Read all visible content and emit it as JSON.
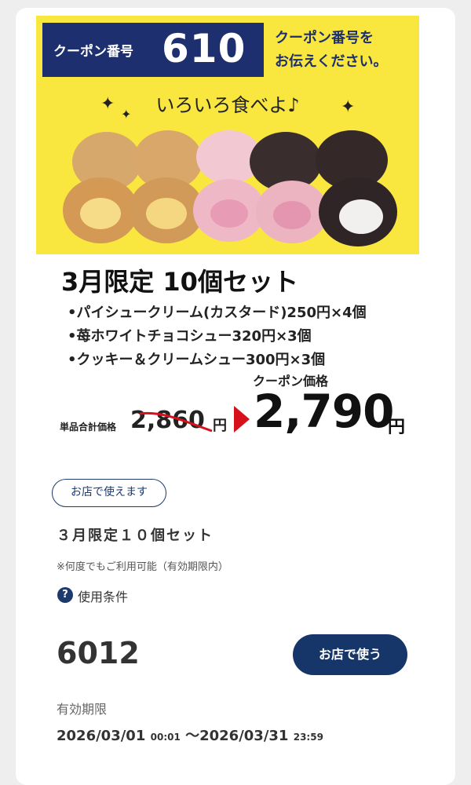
{
  "promo": {
    "coupon_label": "クーポン番号",
    "coupon_number": "610",
    "tell_line1": "クーポン番号を",
    "tell_line2": "お伝えください。",
    "tagline": "いろいろ食べよ♪",
    "colors": {
      "banner_bg": "#f9e740",
      "coupon_box": "#1d2f6e",
      "price_arrow": "#d6111b"
    }
  },
  "set": {
    "title": "3月限定 10個セット",
    "items": [
      "•パイシュークリーム(カスタード)250円×4個",
      "•苺ホワイトチョコシュー320円×3個",
      "•クッキー＆クリームシュー300円×3個"
    ],
    "coupon_price_label": "クーポン価格",
    "single_total_label": "単品合計価格",
    "old_price": "2,860",
    "old_price_yen": "円",
    "new_price": "2,790",
    "new_price_yen": "円"
  },
  "details": {
    "store_badge": "お店で使えます",
    "coupon_name": "３月限定１０個セット",
    "note": "※何度でもご利用可能（有効期限内）",
    "help_icon": "?",
    "terms_label": "使用条件",
    "code": "6012",
    "use_button": "お店で使う",
    "valid_label": "有効期限",
    "valid_start_date": "2026/03/01",
    "valid_start_time": "00:01",
    "valid_sep": " ～",
    "valid_end_date": "2026/03/31",
    "valid_end_time": "23:59",
    "colors": {
      "button_bg": "#16366a",
      "accent": "#1d3a6e"
    }
  }
}
